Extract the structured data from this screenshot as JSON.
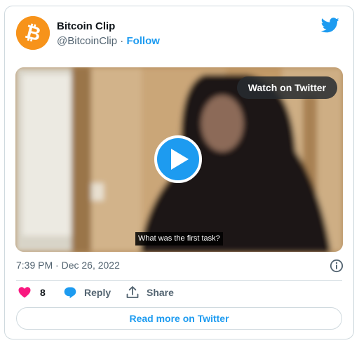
{
  "account": {
    "name": "Bitcoin Clip",
    "handle": "@BitcoinClip",
    "separator": "·",
    "follow_label": "Follow",
    "avatar_icon": "bitcoin-logo",
    "avatar_color": "#f7931a"
  },
  "media": {
    "watch_label": "Watch on Twitter",
    "caption": "What was the first task?",
    "play_icon": "play-icon"
  },
  "meta": {
    "timestamp": "7:39 PM · Dec 26, 2022",
    "info_icon": "info-icon"
  },
  "actions": {
    "like_count": "8",
    "reply_label": "Reply",
    "share_label": "Share"
  },
  "footer": {
    "read_more_label": "Read more on Twitter"
  },
  "colors": {
    "accent": "#1d9bf0",
    "like": "#f91880",
    "text": "#0f1419",
    "muted": "#536471"
  }
}
